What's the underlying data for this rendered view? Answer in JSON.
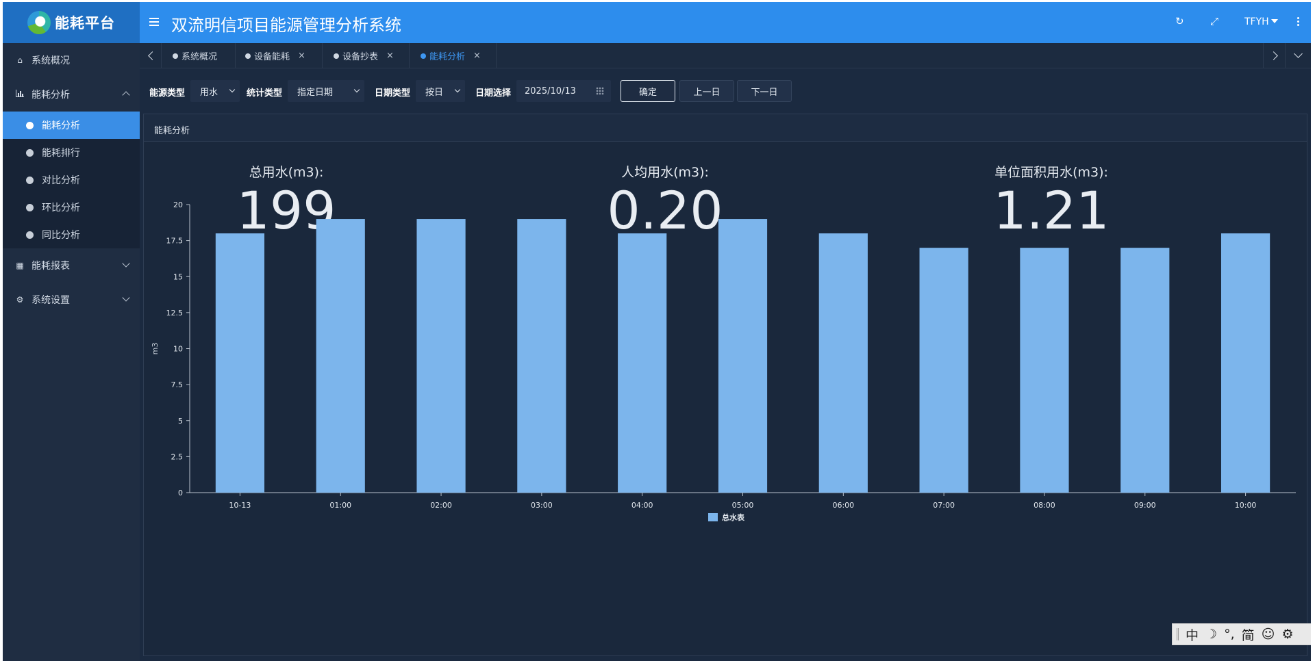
{
  "app": {
    "logo_text": "能耗平台",
    "title": "双流明信项目能源管理分析系统",
    "user": "TFYH"
  },
  "sidebar": {
    "items": [
      {
        "label": "系统概况",
        "icon": "home-icon"
      },
      {
        "label": "能耗分析",
        "icon": "bar-chart-icon",
        "expanded": true
      },
      {
        "label": "能耗报表",
        "icon": "table-icon"
      },
      {
        "label": "系统设置",
        "icon": "gear-icon"
      }
    ],
    "submenu": [
      "能耗分析",
      "能耗排行",
      "对比分析",
      "环比分析",
      "同比分析"
    ],
    "active_sub": "能耗分析"
  },
  "tabs": [
    {
      "label": "系统概况",
      "closable": false
    },
    {
      "label": "设备能耗",
      "closable": true
    },
    {
      "label": "设备抄表",
      "closable": true
    },
    {
      "label": "能耗分析",
      "closable": true,
      "active": true
    }
  ],
  "filters": {
    "energy_type_label": "能源类型",
    "energy_type_value": "用水",
    "stat_type_label": "统计类型",
    "stat_type_value": "指定日期",
    "date_type_label": "日期类型",
    "date_type_value": "按日",
    "date_select_label": "日期选择",
    "date_value": "2025/10/13",
    "confirm": "确定",
    "prev": "上一日",
    "next": "下一日"
  },
  "panel": {
    "title": "能耗分析",
    "kpis": [
      {
        "label": "总用水(m3):",
        "value": "199"
      },
      {
        "label": "人均用水(m3):",
        "value": "0.20"
      },
      {
        "label": "单位面积用水(m3):",
        "value": "1.21"
      }
    ]
  },
  "chart_data": {
    "type": "bar",
    "categories": [
      "10-13",
      "01:00",
      "02:00",
      "03:00",
      "04:00",
      "05:00",
      "06:00",
      "07:00",
      "08:00",
      "09:00",
      "10:00"
    ],
    "series": [
      {
        "name": "总水表",
        "values": [
          18,
          19,
          19,
          19,
          18,
          19,
          18,
          17,
          17,
          17,
          18
        ],
        "color": "#7cb5ec"
      }
    ],
    "ylabel": "m3",
    "ylim": [
      0,
      20
    ],
    "yticks": [
      "0",
      "2.5",
      "5",
      "7.5",
      "10",
      "12.5",
      "15",
      "17.5",
      "20"
    ],
    "legend": "bottom-center",
    "grid": false
  },
  "ime": {
    "lang": "中",
    "moon": "☽",
    "punct": "°,",
    "simp": "简",
    "emoji": "☺",
    "settings": "⚙"
  },
  "colors": {
    "header": "#2d8ded",
    "accent": "#3a8ee6",
    "bar": "#7cb5ec",
    "background": "#1b2a40"
  }
}
